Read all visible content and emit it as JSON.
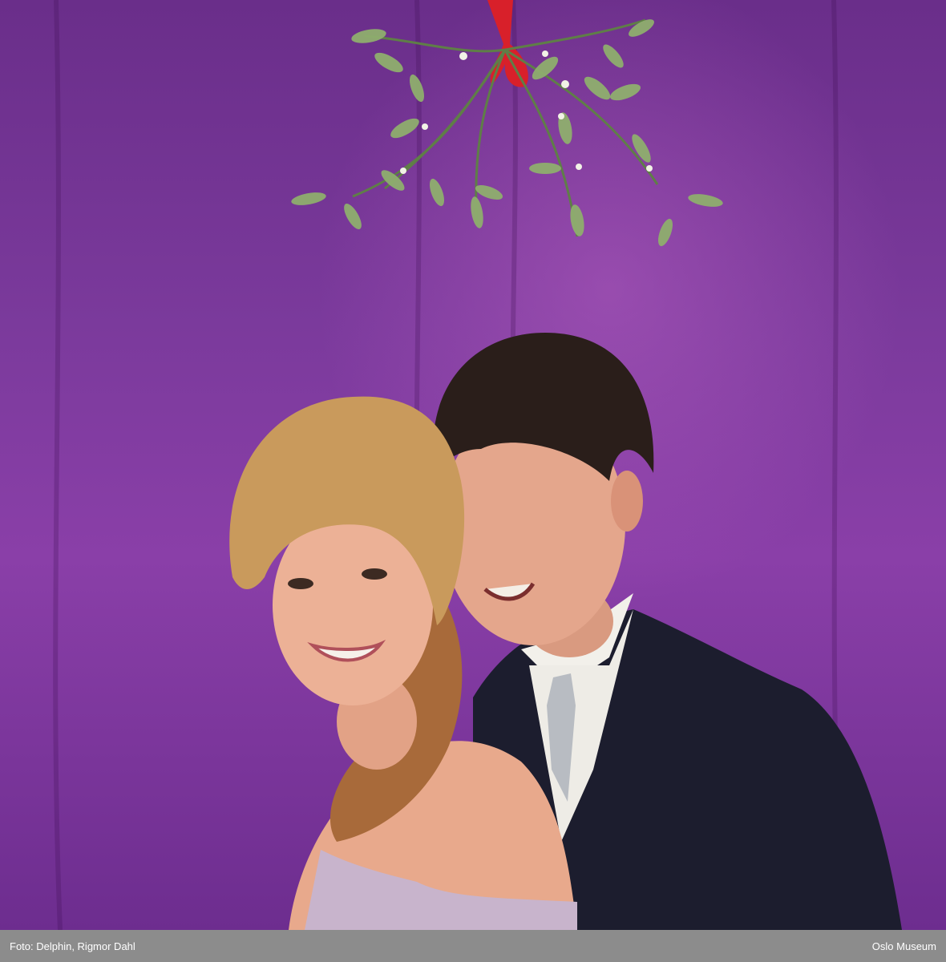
{
  "caption": {
    "credit": "Foto: Delphin, Rigmor Dahl",
    "source": "Oslo Museum"
  },
  "colors": {
    "backdrop": "#7b3a9c",
    "ribbon": "#d8202a",
    "mistletoe_leaf": "#8fae6e",
    "caption_bar": "#8c8c8c"
  }
}
